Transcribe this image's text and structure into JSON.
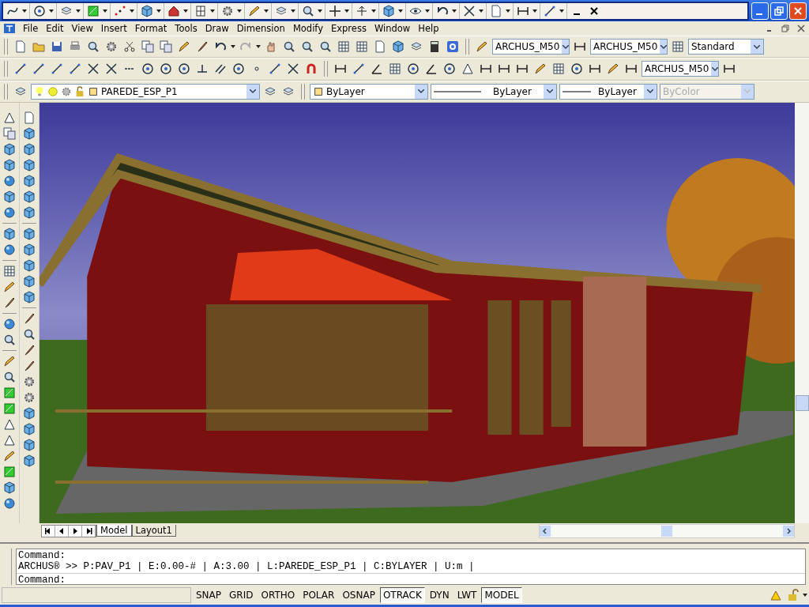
{
  "menu": [
    "File",
    "Edit",
    "View",
    "Insert",
    "Format",
    "Tools",
    "Draw",
    "Dimension",
    "Modify",
    "Express",
    "Window",
    "Help"
  ],
  "style_combos": [
    {
      "value": "ARCHUS_M50"
    },
    {
      "value": "ARCHUS_M50"
    },
    {
      "value": "Standard"
    }
  ],
  "dimension_combo": {
    "value": "ARCHUS_M50"
  },
  "properties_bar": {
    "layer": "PAREDE_ESP_P1",
    "color_setting": "ByLayer",
    "linetype": "ByLayer",
    "lineweight": "ByLayer",
    "plot_style": {
      "value": "ByColor",
      "disabled": true
    }
  },
  "layout_tabs": [
    {
      "label": "Model",
      "selected": true
    },
    {
      "label": "Layout1",
      "selected": false
    }
  ],
  "command_lines": [
    "Command:",
    "ARCHUS® >> P:PAV_P1 | E:0.00-# | A:3.00 | L:PAREDE_ESP_P1 | C:BYLAYER | U:m |"
  ],
  "command_prompt": "Command:",
  "status_buttons": [
    {
      "label": "SNAP",
      "on": false
    },
    {
      "label": "GRID",
      "on": false
    },
    {
      "label": "ORTHO",
      "on": false
    },
    {
      "label": "POLAR",
      "on": false
    },
    {
      "label": "OSNAP",
      "on": false
    },
    {
      "label": "OTRACK",
      "on": true
    },
    {
      "label": "DYN",
      "on": false
    },
    {
      "label": "LWT",
      "on": false
    },
    {
      "label": "MODEL",
      "on": true
    }
  ]
}
